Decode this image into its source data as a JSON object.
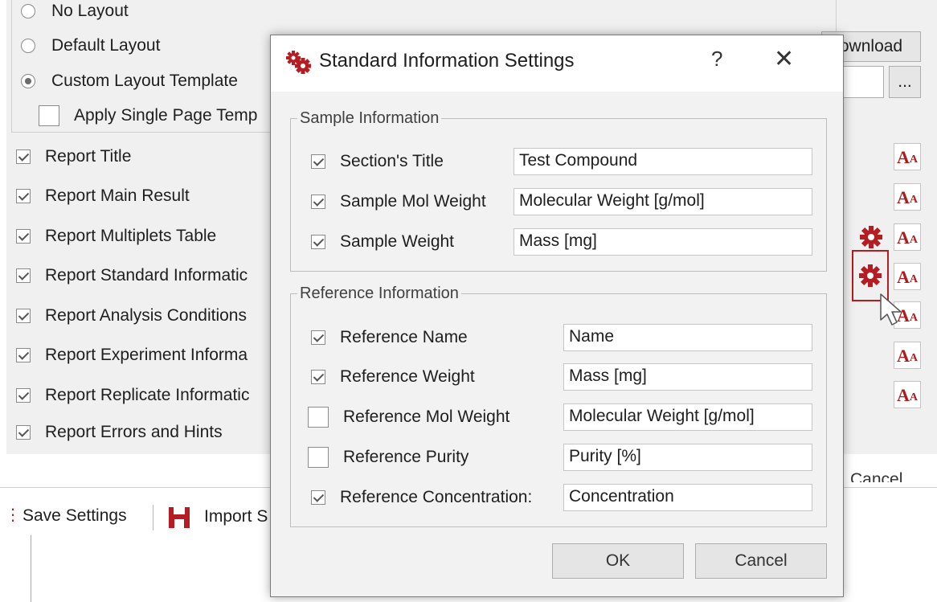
{
  "background_window": {
    "layout_options": [
      {
        "label": "No Layout",
        "selected": false
      },
      {
        "label": "Default Layout",
        "selected": false
      },
      {
        "label": "Custom Layout Template",
        "selected": true
      }
    ],
    "apply_single_page_label": "Apply Single Page Temp",
    "download_label": "ownload",
    "browse_label": "...",
    "report_items": [
      {
        "label": "Report Title",
        "checked": true
      },
      {
        "label": "Report Main Result",
        "checked": true
      },
      {
        "label": "Report Multiplets Table",
        "checked": true
      },
      {
        "label": "Report Standard Informatic",
        "checked": true
      },
      {
        "label": "Report Analysis Conditions",
        "checked": true
      },
      {
        "label": "Report Experiment Informa",
        "checked": true
      },
      {
        "label": "Report Replicate Informatic",
        "checked": true
      },
      {
        "label": "Report Errors and Hints",
        "checked": true
      }
    ],
    "cancel_label": "Cancel",
    "toolbar": {
      "save_settings_label": "Save Settings",
      "import_label": "Import S"
    },
    "font_icon_big": "A",
    "font_icon_small": "A",
    "accent_color": "#b51d22"
  },
  "dialog": {
    "title": "Standard Information Settings",
    "help_label": "?",
    "close_label": "✕",
    "sample_group": {
      "legend": "Sample Information",
      "rows": [
        {
          "label": "Section's Title",
          "checked": true,
          "value": "Test Compound"
        },
        {
          "label": "Sample Mol Weight",
          "checked": true,
          "value": "Molecular Weight [g/mol]"
        },
        {
          "label": "Sample Weight",
          "checked": true,
          "value": "Mass [mg]"
        }
      ]
    },
    "reference_group": {
      "legend": "Reference Information",
      "rows": [
        {
          "label": "Reference Name",
          "checked": true,
          "value": "Name"
        },
        {
          "label": "Reference Weight",
          "checked": true,
          "value": "Mass [mg]"
        },
        {
          "label": "Reference Mol Weight",
          "checked": false,
          "value": "Molecular Weight [g/mol]"
        },
        {
          "label": "Reference Purity",
          "checked": false,
          "value": "Purity [%]"
        },
        {
          "label": "Reference Concentration:",
          "checked": true,
          "value": "Concentration"
        }
      ]
    },
    "ok_label": "OK",
    "cancel_label": "Cancel"
  }
}
